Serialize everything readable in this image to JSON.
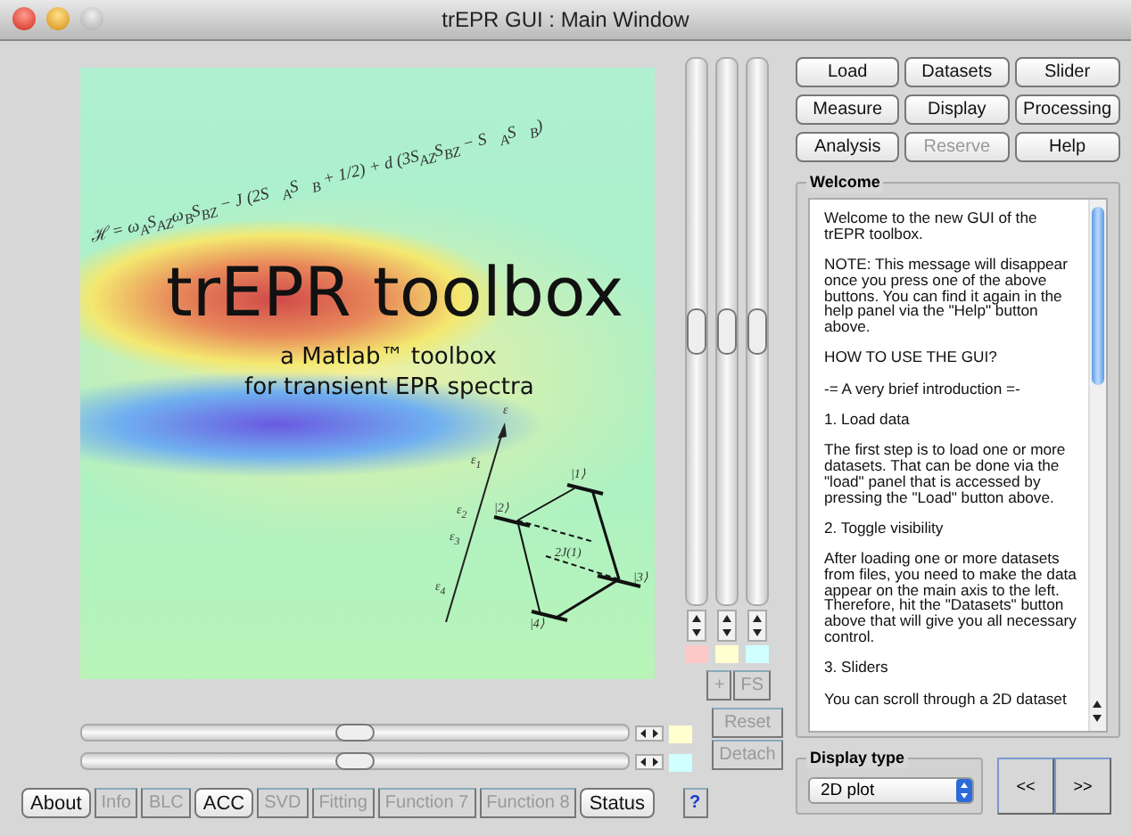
{
  "window": {
    "title": "trEPR GUI : Main Window"
  },
  "splash": {
    "formula": "ℋ = ω$_{A}$S$_{AZ}$ω$_{B}$S$_{BZ}$ − J (2S⃗$_{A}$S⃗$_{B}$ + 1/2) + d (3S$_{AZ}$S$_{BZ}$ − S⃗$_{A}$S⃗$_{B}$)",
    "title": "trEPR toolbox",
    "subtitle": "a Matlab™ toolbox",
    "tagline": "for transient EPR spectra",
    "diagram_labels": [
      "ε",
      "ε$_{1}$",
      "ε$_{2}$",
      "ε$_{3}$",
      "ε$_{4}$",
      "|1⟩",
      "|2⟩",
      "|3⟩",
      "|4⟩",
      "2J(1)"
    ]
  },
  "vertical_sliders": [
    {
      "level": 0.5,
      "color": "#ffc8c8"
    },
    {
      "level": 0.5,
      "color": "#ffffd0"
    },
    {
      "level": 0.5,
      "color": "#d0ffff"
    }
  ],
  "zoom_buttons": [
    {
      "label": "+",
      "disabled": true
    },
    {
      "label": "FS",
      "disabled": true
    }
  ],
  "view_buttons": [
    {
      "label": "Reset",
      "disabled": true
    },
    {
      "label": "Detach",
      "disabled": true
    }
  ],
  "horizontal_sliders": [
    {
      "level": 0.5,
      "color": "#ffffd0"
    },
    {
      "level": 0.5,
      "color": "#d0ffff"
    }
  ],
  "bottom_buttons": [
    {
      "label": "About",
      "disabled": false
    },
    {
      "label": "Info",
      "disabled": true
    },
    {
      "label": "BLC",
      "disabled": true
    },
    {
      "label": "ACC",
      "disabled": false
    },
    {
      "label": "SVD",
      "disabled": true
    },
    {
      "label": "Fitting",
      "disabled": true
    },
    {
      "label": "Function 7",
      "disabled": true
    },
    {
      "label": "Function 8",
      "disabled": true
    },
    {
      "label": "Status",
      "disabled": false
    }
  ],
  "help_button": {
    "label": "?"
  },
  "panel_buttons": [
    {
      "label": "Load",
      "disabled": false
    },
    {
      "label": "Datasets",
      "disabled": false
    },
    {
      "label": "Slider",
      "disabled": false
    },
    {
      "label": "Measure",
      "disabled": false
    },
    {
      "label": "Display",
      "disabled": false
    },
    {
      "label": "Processing",
      "disabled": false
    },
    {
      "label": "Analysis",
      "disabled": false
    },
    {
      "label": "Reserve",
      "disabled": true
    },
    {
      "label": "Help",
      "disabled": false
    }
  ],
  "welcome": {
    "title": "Welcome",
    "paragraphs": [
      "Welcome to the new GUI of the trEPR toolbox.",
      "NOTE: This message will disappear once you press one of the above buttons. You can find it again in the help panel via the \"Help\" button above.",
      "HOW TO USE THE GUI?",
      "-= A very brief introduction =-",
      "1. Load data",
      "The first step is to load one or more datasets. That can be done via the \"load\" panel that is accessed by pressing the \"Load\" button above.",
      "2. Toggle visibility",
      "After loading one or more datasets from files, you need to make the data appear on the main axis to the left. Therefore, hit the \"Datasets\" button above that will give you all necessary control.",
      "3. Sliders",
      "You can scroll through a 2D dataset"
    ]
  },
  "display_type": {
    "title": "Display type",
    "value": "2D plot"
  },
  "nav_buttons": [
    "<<",
    ">>"
  ]
}
